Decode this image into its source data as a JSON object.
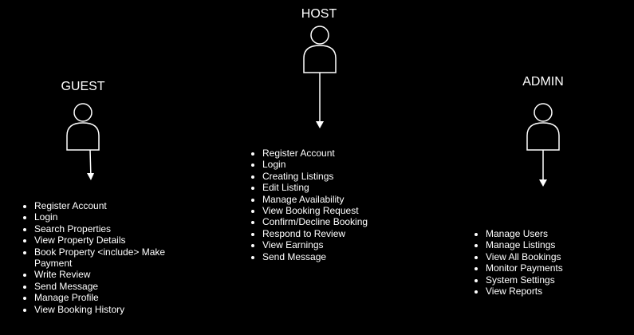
{
  "colors": {
    "background": "#000000",
    "foreground": "#ffffff"
  },
  "actors": {
    "guest": {
      "title": "GUEST",
      "icon": "person-icon",
      "items": [
        "Register Account",
        "Login",
        "Search Properties",
        "View Property Details",
        "Book Property <include> Make Payment",
        "Write Review",
        "Send Message",
        "Manage Profile",
        "View Booking History"
      ]
    },
    "host": {
      "title": "HOST",
      "icon": "person-icon",
      "items": [
        "Register Account",
        "Login",
        "Creating Listings",
        "Edit Listing",
        "Manage Availability",
        "View Booking Request",
        "Confirm/Decline Booking",
        "Respond to Review",
        "View Earnings",
        "Send Message"
      ]
    },
    "admin": {
      "title": "ADMIN",
      "icon": "person-icon",
      "items": [
        "Manage Users",
        "Manage Listings",
        "View All Bookings",
        "Monitor Payments",
        "System Settings",
        "View Reports"
      ]
    }
  }
}
